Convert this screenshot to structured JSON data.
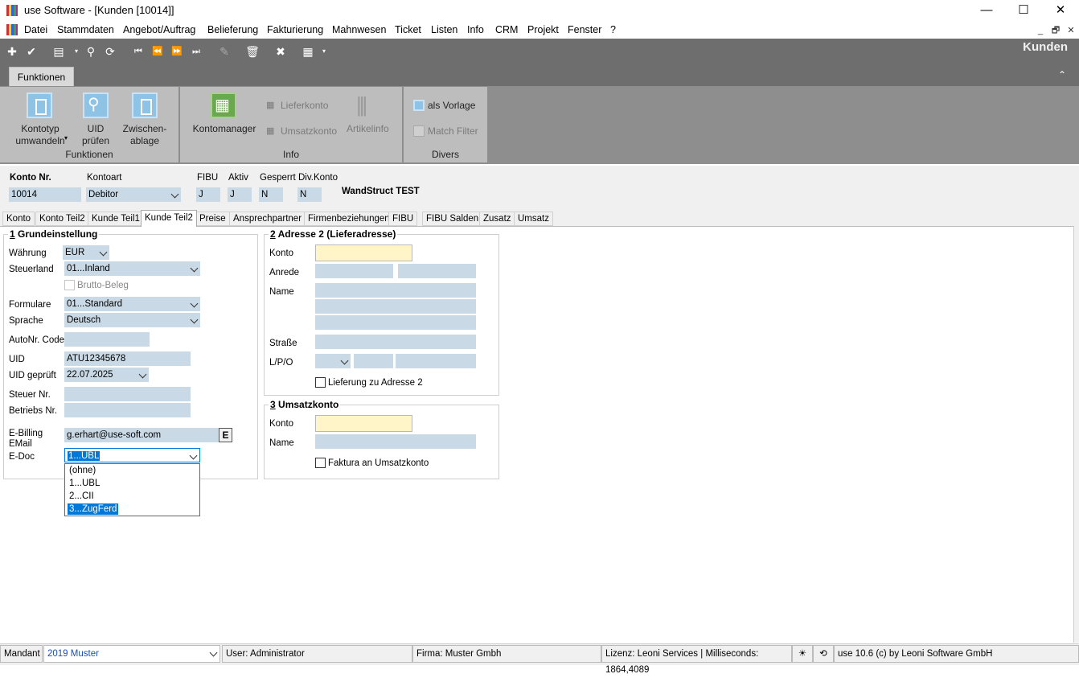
{
  "window": {
    "title": "use Software - [Kunden [10014]]",
    "minimize": "—",
    "maximize": "☐",
    "close": "✕"
  },
  "menu": [
    "Datei",
    "Stammdaten",
    "Angebot/Auftrag",
    "Belieferung",
    "Fakturierung",
    "Mahnwesen",
    "Ticket",
    "Listen",
    "Info",
    "CRM",
    "Projekt",
    "Fenster",
    "?"
  ],
  "mdi": {
    "min": "_",
    "restore": "🗗",
    "close": "✕"
  },
  "toolbar": {
    "module_title": "Kunden"
  },
  "ribbon": {
    "tab": "Funktionen",
    "groups": {
      "funktionen": "Funktionen",
      "info": "Info",
      "divers": "Divers"
    },
    "buttons": {
      "kontotyp": "Kontotyp\numwandeln",
      "uid": "UID\nprüfen",
      "zwischen": "Zwischen-\nablage",
      "kontomanager": "Kontomanager",
      "lieferkonto": "Lieferkonto",
      "umsatzkonto": "Umsatzkonto",
      "artikelinfo": "Artikelinfo",
      "als_vorlage": "als Vorlage",
      "match_filter": "Match Filter"
    }
  },
  "header": {
    "konto_nr_label": "Konto Nr.",
    "konto_nr": "10014",
    "kontoart_label": "Kontoart",
    "kontoart": "Debitor",
    "fibu_label": "FIBU",
    "fibu": "J",
    "aktiv_label": "Aktiv",
    "aktiv": "J",
    "gesperrt_label": "Gesperrt",
    "gesperrt": "N",
    "divkonto_label": "Div.Konto",
    "divkonto": "N",
    "name": "WandStruct TEST"
  },
  "tabs": [
    "Konto",
    "Konto Teil2",
    "Kunde Teil1",
    "Kunde Teil2",
    "Preise",
    "Ansprechpartner",
    "Firmenbeziehungen",
    "FIBU",
    "FIBU Salden",
    "Zusatz",
    "Umsatz"
  ],
  "sec1": {
    "num": "1",
    "title": " Grundeinstellung",
    "waehrung_label": "Währung",
    "waehrung": "EUR",
    "steuerland_label": "Steuerland",
    "steuerland": "01...Inland",
    "brutto_label": "Brutto-Beleg",
    "formulare_label": "Formulare",
    "formulare": "01...Standard",
    "sprache_label": "Sprache",
    "sprache": "Deutsch",
    "autonr_label": "AutoNr. Code",
    "autonr": "",
    "uid_label": "UID",
    "uid": "ATU12345678",
    "uidgeprueft_label": "UID geprüft",
    "uidgeprueft": "22.07.2025",
    "steuernr_label": "Steuer Nr.",
    "steuernr": "",
    "betriebsnr_label": "Betriebs Nr.",
    "betriebsnr": "",
    "ebilling_label1": "E-Billing",
    "ebilling_label2": "EMail",
    "ebilling": "g.erhart@use-soft.com",
    "ebilling_btn": "E",
    "edoc_label": "E-Doc",
    "edoc": "1...UBL",
    "edoc_options": [
      "(ohne)",
      "1...UBL",
      "2...CII",
      "3...ZugFerd"
    ]
  },
  "sec2": {
    "num": "2",
    "title": " Adresse 2 (Lieferadresse)",
    "konto_label": "Konto",
    "anrede_label": "Anrede",
    "name_label": "Name",
    "strasse_label": "Straße",
    "lpo_label": "L/P/O",
    "lieferung_label": "Lieferung zu Adresse 2"
  },
  "sec3": {
    "num": "3",
    "title": " Umsatzkonto",
    "konto_label": "Konto",
    "name_label": "Name",
    "faktura_label": "Faktura an Umsatzkonto"
  },
  "status": {
    "mandant_label": "Mandant",
    "mandant": "2019 Muster",
    "user": "User: Administrator",
    "firma": "Firma: Muster Gmbh",
    "lizenz": "Lizenz: Leoni Services | Milliseconds: 1864,4089",
    "version": "use 10.6 (c) by Leoni Software GmbH"
  },
  "colors": {
    "toolbar": "#6e6e6e",
    "ribbon": "#bdbdbd",
    "field": "#c9d9e6",
    "yellow_field": "#fff5c9",
    "selection": "#0078d7"
  }
}
